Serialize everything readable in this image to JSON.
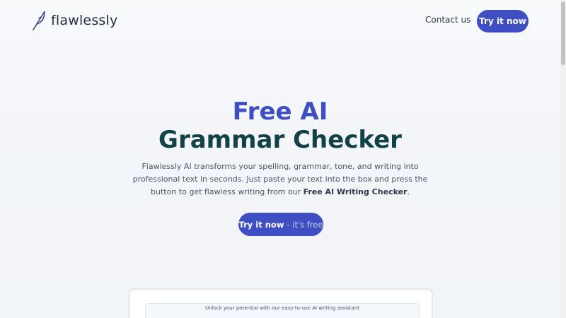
{
  "header": {
    "brand": "flawlessly",
    "logo_icon": "feather-pen-icon",
    "contact_label": "Contact us",
    "try_label": "Try it now"
  },
  "hero": {
    "title_line1": "Free AI",
    "title_line2": "Grammar Checker",
    "description_part1": "Flawlessly AI transforms your spelling, grammar, tone, and writing into professional text in seconds. Just paste your text into the box and press the button to get flawless writing from our ",
    "description_bold": "Free AI Writing Checker",
    "description_end": ".",
    "cta_main": "Try it now",
    "cta_sub": "- it's free"
  },
  "panel": {
    "caption": "Unlock your potential with our easy-to-use AI writing assistant"
  },
  "colors": {
    "accent": "#3f4fc3",
    "heading_dark": "#124247"
  }
}
